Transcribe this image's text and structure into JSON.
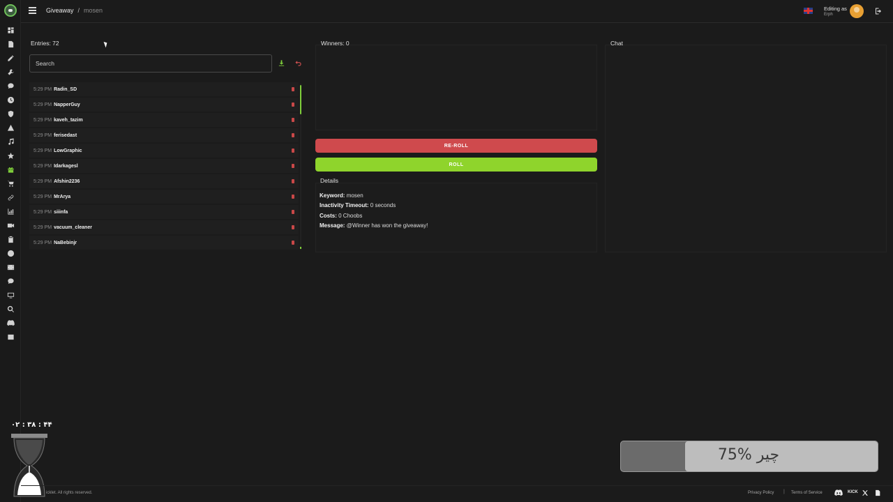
{
  "header": {
    "breadcrumb_root": "Giveaway",
    "breadcrumb_sep": "/",
    "breadcrumb_current": "mosen",
    "editing_label": "Editing as",
    "editing_user": "Erph"
  },
  "sidebar": {
    "icons": [
      "dashboard-icon",
      "document-icon",
      "pen-icon",
      "tool-icon",
      "chat-icon",
      "clock-icon",
      "shield-icon",
      "alert-icon",
      "music-icon",
      "star-icon",
      "gift-icon",
      "cart-icon",
      "link-icon",
      "chart-icon",
      "video-icon",
      "clipboard-icon",
      "emoji-icon",
      "film-icon",
      "message-icon",
      "monitor-icon",
      "search-icon",
      "discord-icon",
      "list-icon"
    ],
    "active_icon": "gift-icon"
  },
  "entries": {
    "title": "Entries: 72",
    "search_placeholder": "Search",
    "items": [
      {
        "time": "5:29 PM",
        "user": "Radin_SD"
      },
      {
        "time": "5:29 PM",
        "user": "NapperGuy"
      },
      {
        "time": "5:29 PM",
        "user": "kaveh_tazim"
      },
      {
        "time": "5:29 PM",
        "user": "ferisedast"
      },
      {
        "time": "5:29 PM",
        "user": "LowGraphic"
      },
      {
        "time": "5:29 PM",
        "user": "Idarkagesl"
      },
      {
        "time": "5:29 PM",
        "user": "Afshin2236"
      },
      {
        "time": "5:29 PM",
        "user": "MrArya"
      },
      {
        "time": "5:29 PM",
        "user": "siiinfa"
      },
      {
        "time": "5:29 PM",
        "user": "vacuum_cleaner"
      },
      {
        "time": "5:29 PM",
        "user": "NaBebinjr"
      }
    ]
  },
  "winners": {
    "title": "Winners: 0",
    "reroll_label": "RE-ROLL",
    "roll_label": "ROLL"
  },
  "details": {
    "title": "Details",
    "keyword_label": "Keyword:",
    "keyword_value": "mosen",
    "timeout_label": "Inactivity Timeout:",
    "timeout_value": "0 seconds",
    "costs_label": "Costs:",
    "costs_value": "0 Choobs",
    "message_label": "Message:",
    "message_value": "@Winner has won the giveaway!"
  },
  "chat": {
    "title": "Chat"
  },
  "overlay": {
    "timer": "۰۲ : ۳۸ : ۴۴",
    "progress_text": "75% چیر",
    "progress_fraction": 0.75
  },
  "footer": {
    "copyright": "icklet. All rights reserved.",
    "privacy": "Privacy Policy",
    "sep": "|",
    "terms": "Terms of Service",
    "kick": "KICK"
  },
  "colors": {
    "accent_green": "#7fce3b",
    "reroll_red": "#cf4a4d",
    "roll_green": "#8fd42c"
  }
}
